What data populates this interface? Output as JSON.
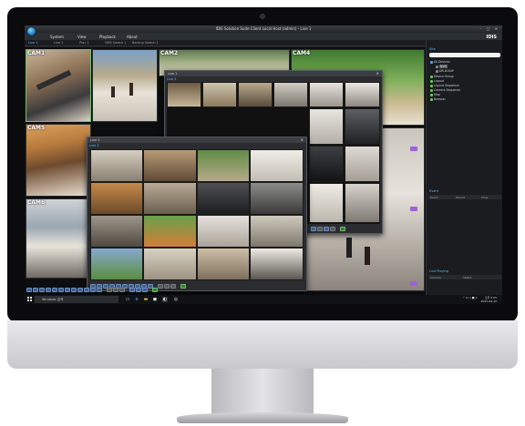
{
  "app": {
    "title": "IDIS Solution Suite Client Local Host (admin) - Live 1",
    "brand": "IDIS",
    "window_controls": "– □ ✕"
  },
  "menu": [
    "System",
    "View",
    "Playback",
    "About"
  ],
  "tabs": [
    {
      "label": "Live 1",
      "active": true
    },
    {
      "label": "Live 2",
      "active": false
    },
    {
      "label": "Play 1",
      "active": false
    },
    {
      "label": "VMS Switch 1",
      "active": false
    },
    {
      "label": "Backup Switch 1",
      "active": false
    }
  ],
  "cameras": [
    {
      "label": "CAM1"
    },
    {
      "label": "CAM2"
    },
    {
      "label": "CAM4"
    },
    {
      "label": "CAM5"
    },
    {
      "label": "CAM6"
    }
  ],
  "subwin_back": {
    "title": "Live 2",
    "tab": "Live 2"
  },
  "subwin_front": {
    "title": "Live 3",
    "tab": "Live 3"
  },
  "sidebar": {
    "site_header": "Site",
    "tree": [
      {
        "label": "All Devices",
        "color": "#4aa3ff"
      },
      {
        "label": "NVR",
        "color": "#e0e0e0"
      },
      {
        "label": "DR-8164P",
        "color": "#e0e0e0"
      },
      {
        "label": "Device Group",
        "color": "#58d04a"
      },
      {
        "label": "Layout",
        "color": "#58d04a"
      },
      {
        "label": "Layout Sequence",
        "color": "#58d04a"
      },
      {
        "label": "Camera Sequence",
        "color": "#58d04a"
      },
      {
        "label": "Map",
        "color": "#58d04a"
      },
      {
        "label": "Browser",
        "color": "#58d04a"
      }
    ],
    "event_header": "Event",
    "event_columns": [
      "Event",
      "Device",
      "Time"
    ],
    "list_header": "Live Playing",
    "list_columns": [
      "Camera",
      "Status"
    ]
  },
  "taskbar": {
    "search_placeholder": "Windows 검색",
    "time": "오후 5:05",
    "date": "2015-09-10",
    "tray_icons": "^ ⊡ ◁ ■ A"
  }
}
